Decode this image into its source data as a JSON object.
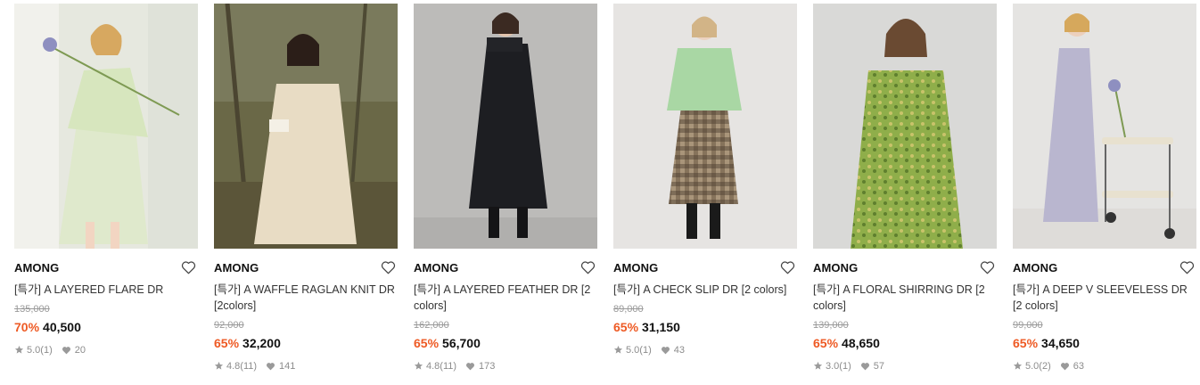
{
  "products": [
    {
      "brand": "AMONG",
      "title": "[특가] A LAYERED FLARE DR",
      "original_price": "135,000",
      "discount": "70%",
      "price": "40,500",
      "rating": "5.0",
      "reviews": "(1)",
      "likes": "20",
      "image_tone": "#e2e5dc"
    },
    {
      "brand": "AMONG",
      "title": "[특가] A WAFFLE RAGLAN KNIT DR [2colors]",
      "original_price": "92,000",
      "discount": "65%",
      "price": "32,200",
      "rating": "4.8",
      "reviews": "(11)",
      "likes": "141",
      "image_tone": "#6d6a4d"
    },
    {
      "brand": "AMONG",
      "title": "[특가] A LAYERED FEATHER DR [2 colors]",
      "original_price": "162,000",
      "discount": "65%",
      "price": "56,700",
      "rating": "4.8",
      "reviews": "(11)",
      "likes": "173",
      "image_tone": "#bdbcba"
    },
    {
      "brand": "AMONG",
      "title": "[특가] A CHECK SLIP DR [2 colors]",
      "original_price": "89,000",
      "discount": "65%",
      "price": "31,150",
      "rating": "5.0",
      "reviews": "(1)",
      "likes": "43",
      "image_tone": "#e6e4e2"
    },
    {
      "brand": "AMONG",
      "title": "[특가] A FLORAL SHIRRING DR [2 colors]",
      "original_price": "139,000",
      "discount": "65%",
      "price": "48,650",
      "rating": "3.0",
      "reviews": "(1)",
      "likes": "57",
      "image_tone": "#d8d8d6"
    },
    {
      "brand": "AMONG",
      "title": "[특가] A DEEP V SLEEVELESS DR [2 colors]",
      "original_price": "99,000",
      "discount": "65%",
      "price": "34,650",
      "rating": "5.0",
      "reviews": "(2)",
      "likes": "63",
      "image_tone": "#e4e3e1"
    }
  ],
  "colors": {
    "discount": "#ee5a24",
    "brand": "#111111",
    "muted": "#9a9a9a"
  }
}
